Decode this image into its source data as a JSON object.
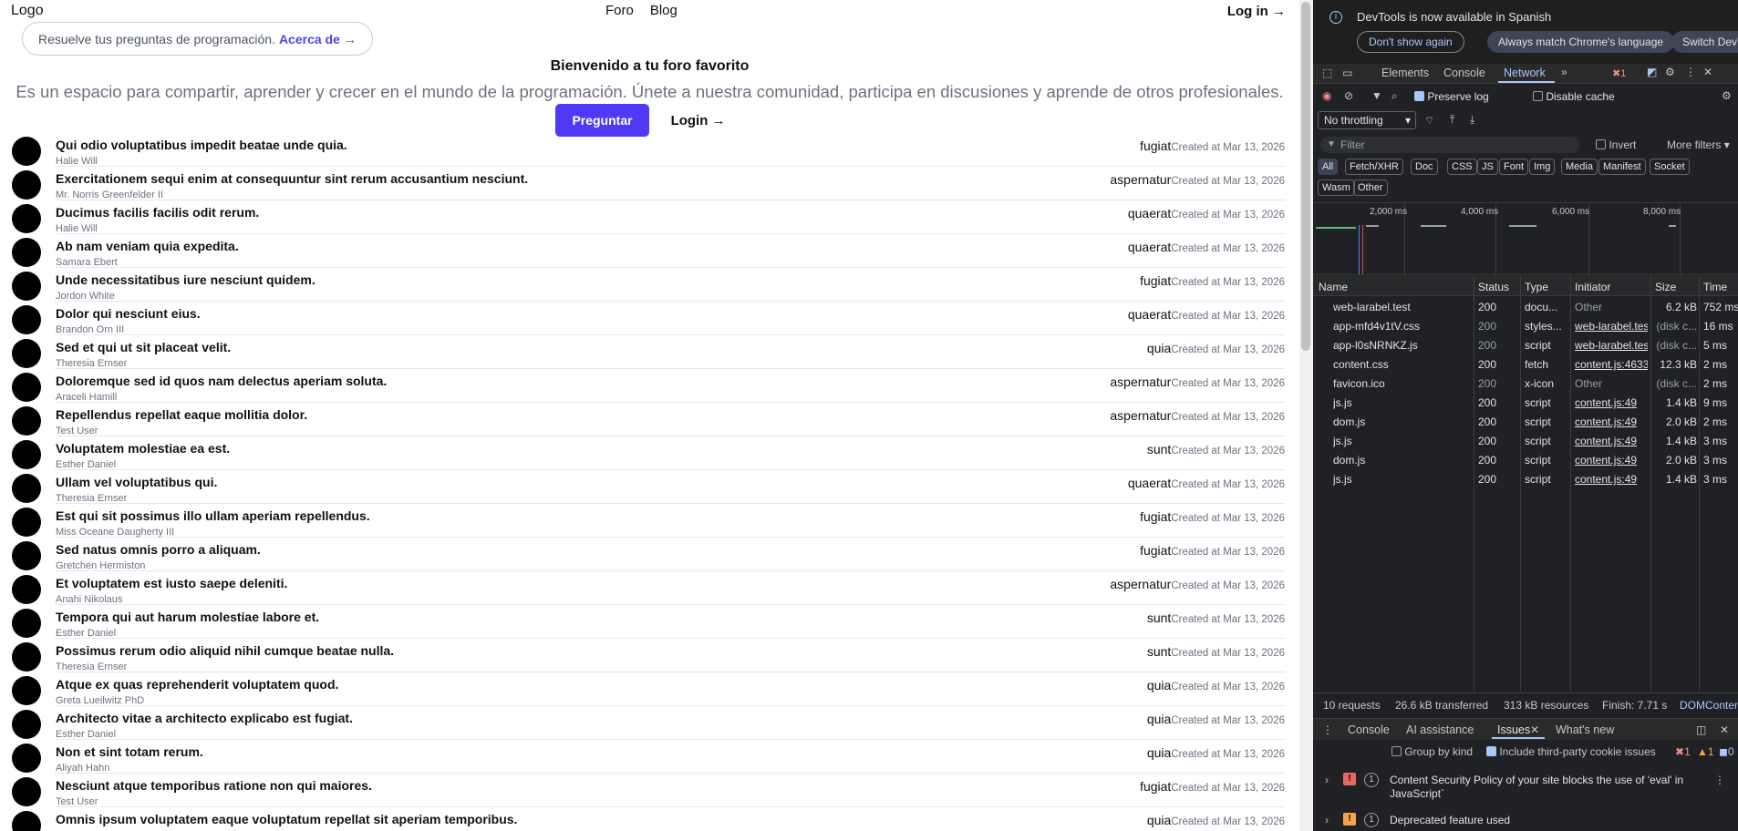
{
  "site": {
    "logo": "Logo",
    "nav": [
      "Foro",
      "Blog"
    ],
    "login_top": "Log in →",
    "announcement": {
      "text": "Resuelve tus preguntas de programación.",
      "link": "Acerca de →"
    },
    "hero": {
      "title": "Bienvenido a tu foro favorito",
      "subtitle": "Es un espacio para compartir, aprender y crecer en el mundo de la programación. Únete a nuestra comunidad, participa en discusiones y aprende de otros profesionales.",
      "primary_button": "Preguntar",
      "secondary_link": "Login →"
    },
    "posts": [
      {
        "title": "Qui odio voluptatibus impedit beatae unde quia.",
        "author": "Halie Will",
        "tag": "fugiat",
        "date": "Created at Mar 13, 2026"
      },
      {
        "title": "Exercitationem sequi enim at consequuntur sint rerum accusantium nesciunt.",
        "author": "Mr. Norris Greenfelder II",
        "tag": "aspernatur",
        "date": "Created at Mar 13, 2026"
      },
      {
        "title": "Ducimus facilis facilis odit rerum.",
        "author": "Halie Will",
        "tag": "quaerat",
        "date": "Created at Mar 13, 2026"
      },
      {
        "title": "Ab nam veniam quia expedita.",
        "author": "Samara Ebert",
        "tag": "quaerat",
        "date": "Created at Mar 13, 2026"
      },
      {
        "title": "Unde necessitatibus iure nesciunt quidem.",
        "author": "Jordon White",
        "tag": "fugiat",
        "date": "Created at Mar 13, 2026"
      },
      {
        "title": "Dolor qui nesciunt eius.",
        "author": "Brandon Orn III",
        "tag": "quaerat",
        "date": "Created at Mar 13, 2026"
      },
      {
        "title": "Sed et qui ut sit placeat velit.",
        "author": "Theresia Ernser",
        "tag": "quia",
        "date": "Created at Mar 13, 2026"
      },
      {
        "title": "Doloremque sed id quos nam delectus aperiam soluta.",
        "author": "Araceli Hamill",
        "tag": "aspernatur",
        "date": "Created at Mar 13, 2026"
      },
      {
        "title": "Repellendus repellat eaque mollitia dolor.",
        "author": "Test User",
        "tag": "aspernatur",
        "date": "Created at Mar 13, 2026"
      },
      {
        "title": "Voluptatem molestiae ea est.",
        "author": "Esther Daniel",
        "tag": "sunt",
        "date": "Created at Mar 13, 2026"
      },
      {
        "title": "Ullam vel voluptatibus qui.",
        "author": "Theresia Ernser",
        "tag": "quaerat",
        "date": "Created at Mar 13, 2026"
      },
      {
        "title": "Est qui sit possimus illo ullam aperiam repellendus.",
        "author": "Miss Oceane Daugherty III",
        "tag": "fugiat",
        "date": "Created at Mar 13, 2026"
      },
      {
        "title": "Sed natus omnis porro a aliquam.",
        "author": "Gretchen Hermiston",
        "tag": "fugiat",
        "date": "Created at Mar 13, 2026"
      },
      {
        "title": "Et voluptatem est iusto saepe deleniti.",
        "author": "Anahi Nikolaus",
        "tag": "aspernatur",
        "date": "Created at Mar 13, 2026"
      },
      {
        "title": "Tempora qui aut harum molestiae labore et.",
        "author": "Esther Daniel",
        "tag": "sunt",
        "date": "Created at Mar 13, 2026"
      },
      {
        "title": "Possimus rerum odio aliquid nihil cumque beatae nulla.",
        "author": "Theresia Ernser",
        "tag": "sunt",
        "date": "Created at Mar 13, 2026"
      },
      {
        "title": "Atque ex quas reprehenderit voluptatem quod.",
        "author": "Greta Lueilwitz PhD",
        "tag": "quia",
        "date": "Created at Mar 13, 2026"
      },
      {
        "title": "Architecto vitae a architecto explicabo est fugiat.",
        "author": "Esther Daniel",
        "tag": "quia",
        "date": "Created at Mar 13, 2026"
      },
      {
        "title": "Non et sint totam rerum.",
        "author": "Aliyah Hahn",
        "tag": "quia",
        "date": "Created at Mar 13, 2026"
      },
      {
        "title": "Nesciunt atque temporibus ratione non qui maiores.",
        "author": "Test User",
        "tag": "fugiat",
        "date": "Created at Mar 13, 2026"
      },
      {
        "title": "Omnis ipsum voluptatem eaque voluptatum repellat sit aperiam temporibus.",
        "author": "",
        "tag": "quia",
        "date": "Created at Mar 13, 2026"
      }
    ]
  },
  "devtools": {
    "notice": {
      "message": "DevTools is now available in Spanish",
      "dont_show": "Don't show again",
      "match_language": "Always match Chrome's language",
      "switch": "Switch DevTools to Spanish"
    },
    "tabs": [
      "Elements",
      "Console",
      "Network"
    ],
    "active_tab": "Network",
    "error_count": "1",
    "toolbar": {
      "preserve_log": "Preserve log",
      "disable_cache": "Disable cache",
      "throttling": "No throttling"
    },
    "filter": {
      "placeholder": "Filter",
      "invert": "Invert",
      "more_filters": "More filters"
    },
    "type_filters": [
      "All",
      "Fetch/XHR",
      "Doc",
      "CSS",
      "JS",
      "Font",
      "Img",
      "Media",
      "Manifest",
      "Socket",
      "Wasm",
      "Other"
    ],
    "timeline_labels": [
      "2,000 ms",
      "4,000 ms",
      "6,000 ms",
      "8,000 ms"
    ],
    "columns": [
      "Name",
      "Status",
      "Type",
      "Initiator",
      "Size",
      "Time"
    ],
    "requests": [
      {
        "name": "web-larabel.test",
        "status": "200",
        "type": "docu...",
        "initiator": "Other",
        "size": "6.2 kB",
        "time": "752 ms",
        "icon": "document"
      },
      {
        "name": "app-mfd4v1tV.css",
        "status": "200",
        "type": "styles...",
        "initiator": "web-larabel.test",
        "size": "(disk c...",
        "time": "16 ms",
        "icon": "stylesheet"
      },
      {
        "name": "app-l0sNRNKZ.js",
        "status": "200",
        "type": "script",
        "initiator": "web-larabel.test",
        "size": "(disk c...",
        "time": "5 ms",
        "icon": "script"
      },
      {
        "name": "content.css",
        "status": "200",
        "type": "fetch",
        "initiator": "content.js:4633",
        "size": "12.3 kB",
        "time": "2 ms",
        "icon": "stylesheet"
      },
      {
        "name": "favicon.ico",
        "status": "200",
        "type": "x-icon",
        "initiator": "Other",
        "size": "(disk c...",
        "time": "2 ms",
        "icon": "favicon"
      },
      {
        "name": "js.js",
        "status": "200",
        "type": "script",
        "initiator": "content.js:49",
        "size": "1.4 kB",
        "time": "9 ms",
        "icon": "script"
      },
      {
        "name": "dom.js",
        "status": "200",
        "type": "script",
        "initiator": "content.js:49",
        "size": "2.0 kB",
        "time": "2 ms",
        "icon": "script"
      },
      {
        "name": "js.js",
        "status": "200",
        "type": "script",
        "initiator": "content.js:49",
        "size": "1.4 kB",
        "time": "3 ms",
        "icon": "script"
      },
      {
        "name": "dom.js",
        "status": "200",
        "type": "script",
        "initiator": "content.js:49",
        "size": "2.0 kB",
        "time": "3 ms",
        "icon": "script"
      },
      {
        "name": "js.js",
        "status": "200",
        "type": "script",
        "initiator": "content.js:49",
        "size": "1.4 kB",
        "time": "3 ms",
        "icon": "script"
      }
    ],
    "summary": {
      "requests": "10 requests",
      "transferred": "26.6 kB transferred",
      "resources": "313 kB resources",
      "finish": "Finish: 7.71 s",
      "dom": "DOMContentLoaded"
    },
    "drawer": {
      "tabs": [
        "Console",
        "AI assistance",
        "Issues",
        "What's new"
      ],
      "active_tab": "Issues",
      "group_by_kind": "Group by kind",
      "include_third_party": "Include third-party cookie issues",
      "badge_error": "1",
      "badge_warn": "1",
      "badge_info": "0"
    },
    "issues": [
      {
        "severity": "error",
        "count": "1",
        "text": "Content Security Policy of your site blocks the use of 'eval' in JavaScript`"
      },
      {
        "severity": "warning",
        "count": "1",
        "text": "Deprecated feature used"
      }
    ],
    "colors": {
      "accent": "#a8c7fa",
      "background": "#202124",
      "error": "#e46962",
      "warning": "#f7a24f"
    }
  },
  "colors": {
    "primary_button": "#4f39f6",
    "link": "#4f46e5"
  }
}
